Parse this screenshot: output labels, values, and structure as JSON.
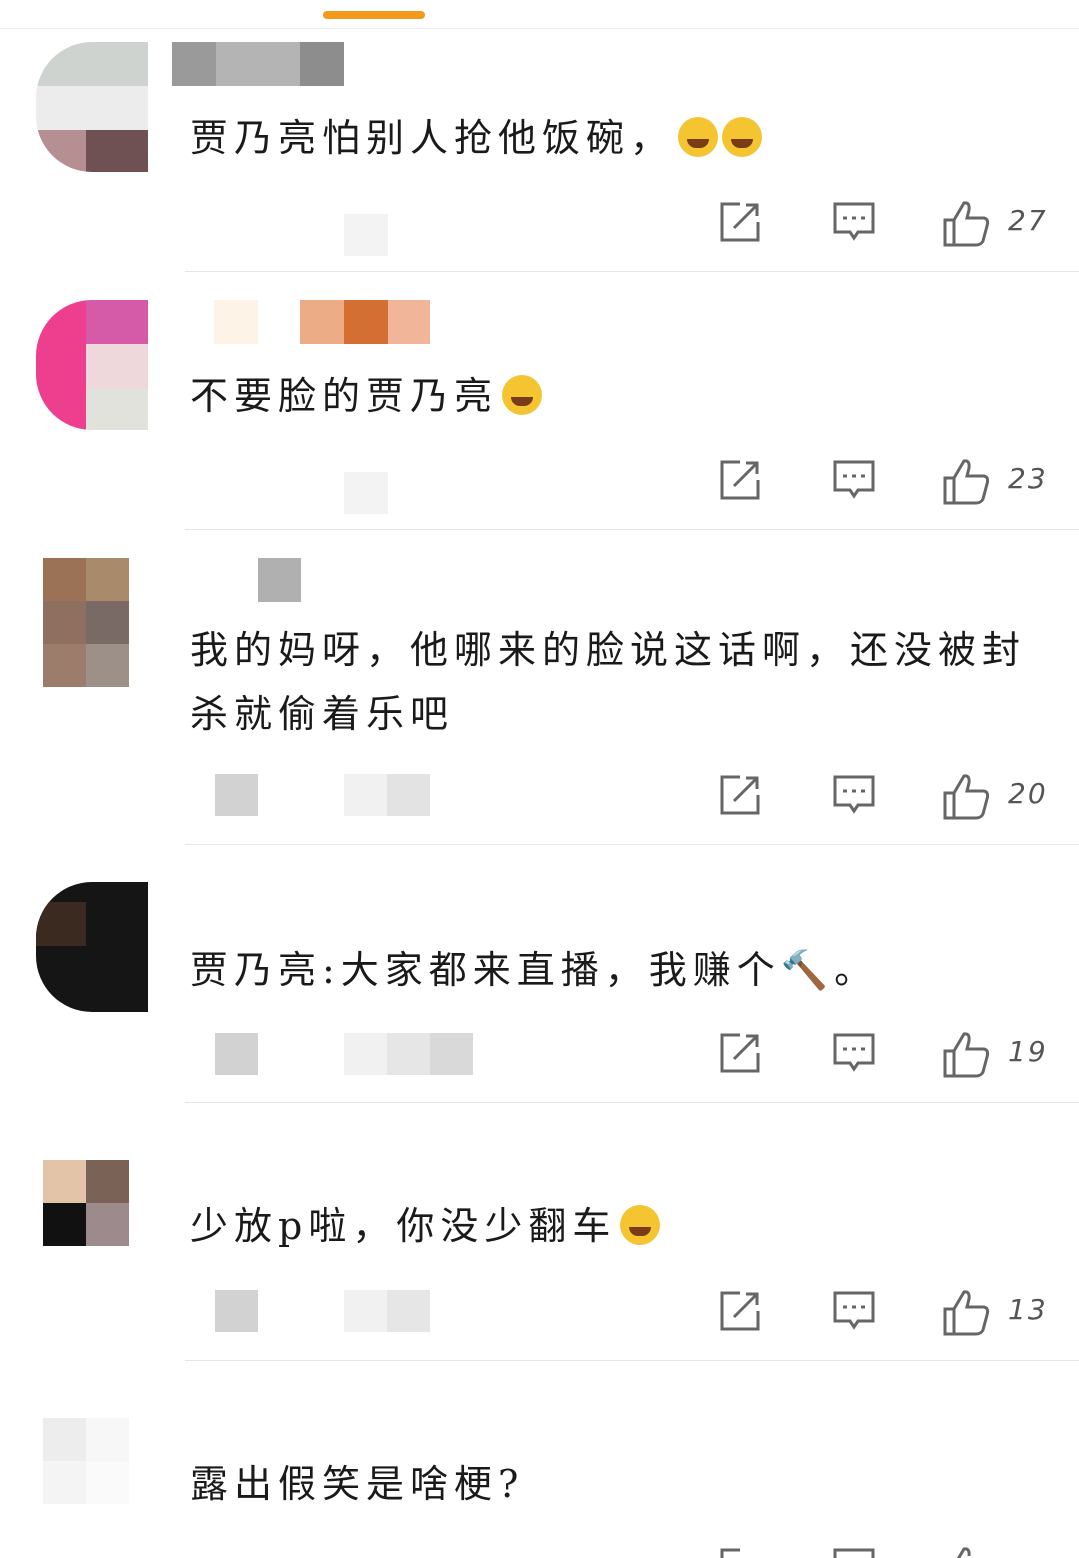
{
  "comments": [
    {
      "text": "贾乃亮怕别人抢他饭碗，",
      "trailing_emoji": "laugh-cry-emoji",
      "likes": "27"
    },
    {
      "text": "不要脸的贾乃亮",
      "trailing_emoji": "crying-emoji",
      "likes": "23"
    },
    {
      "text": "我的妈呀，他哪来的脸说这话啊，还没被封杀就偷着乐吧",
      "trailing_emoji": "",
      "likes": "20"
    },
    {
      "text": "贾乃亮:大家都来直播，我赚个",
      "trailing_emoji": "hammer-emoji",
      "text_end": "。",
      "likes": "19"
    },
    {
      "text": "少放p啦，你没少翻车",
      "trailing_emoji": "grin-emoji",
      "likes": "13"
    },
    {
      "text": "露出假笑是啥梗?",
      "trailing_emoji": "",
      "likes": ""
    }
  ],
  "colors": {
    "accent": "#f19a1c",
    "icon": "#666666",
    "divider": "#e6e6e6"
  }
}
